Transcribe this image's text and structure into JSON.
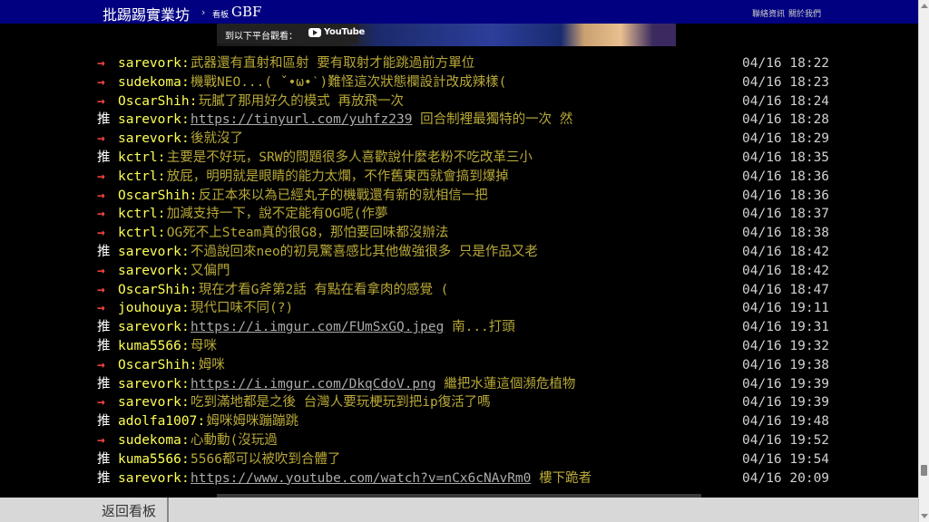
{
  "header": {
    "site_title": "批踢踢實業坊",
    "separator": "›",
    "board_prefix": "看板",
    "board_name": "GBF",
    "links": [
      "聯絡資訊",
      "關於我們"
    ]
  },
  "embed": {
    "watch_label": "到以下平台觀看：",
    "platform": "YouTube"
  },
  "pushes": [
    {
      "tag": "→",
      "user": "sarevork",
      "content": "武器還有直射和區射 要有取射才能跳過前方單位",
      "link": "",
      "after": "",
      "time": "04/16 18:22"
    },
    {
      "tag": "→",
      "user": "sudekoma",
      "content": "機戰NEO...( ˇ•ω•ˋ)難怪這次狀態欄設計改成辣樣(",
      "link": "",
      "after": "",
      "time": "04/16 18:23"
    },
    {
      "tag": "→",
      "user": "OscarShih",
      "content": "玩膩了那用好久的模式 再放飛一次",
      "link": "",
      "after": "",
      "time": "04/16 18:24"
    },
    {
      "tag": "推",
      "user": "sarevork",
      "content": "",
      "link": "https://tinyurl.com/yuhfz239",
      "after": " 回合制裡最獨特的一次 然",
      "time": "04/16 18:28"
    },
    {
      "tag": "→",
      "user": "sarevork",
      "content": "後就沒了",
      "link": "",
      "after": "",
      "time": "04/16 18:29"
    },
    {
      "tag": "推",
      "user": "kctrl",
      "content": "主要是不好玩，SRW的問題很多人喜歡說什麼老粉不吃改革三小",
      "link": "",
      "after": "",
      "time": "04/16 18:35"
    },
    {
      "tag": "→",
      "user": "kctrl",
      "content": "放屁，明明就是眼睛的能力太爛，不作舊東西就會搞到爆掉",
      "link": "",
      "after": "",
      "time": "04/16 18:36"
    },
    {
      "tag": "→",
      "user": "OscarShih",
      "content": "反正本來以為已經丸子的機戰還有新的就相信一把",
      "link": "",
      "after": "",
      "time": "04/16 18:36"
    },
    {
      "tag": "→",
      "user": "kctrl",
      "content": "加減支持一下，說不定能有OG呢(作夢",
      "link": "",
      "after": "",
      "time": "04/16 18:37"
    },
    {
      "tag": "→",
      "user": "kctrl",
      "content": "OG死不上Steam真的很G8，那怕要回味都沒辦法",
      "link": "",
      "after": "",
      "time": "04/16 18:38"
    },
    {
      "tag": "推",
      "user": "sarevork",
      "content": "不過說回來neo的初見驚喜感比其他做強很多 只是作品又老",
      "link": "",
      "after": "",
      "time": "04/16 18:42"
    },
    {
      "tag": "→",
      "user": "sarevork",
      "content": "又偏門",
      "link": "",
      "after": "",
      "time": "04/16 18:42"
    },
    {
      "tag": "→",
      "user": "OscarShih",
      "content": "現在才看G斧第2話 有點在看拿肉的感覺 (",
      "link": "",
      "after": "",
      "time": "04/16 18:47"
    },
    {
      "tag": "→",
      "user": "jouhouya",
      "content": "現代口味不同(?)",
      "link": "",
      "after": "",
      "time": "04/16 19:11"
    },
    {
      "tag": "推",
      "user": "sarevork",
      "content": "",
      "link": "https://i.imgur.com/FUmSxGQ.jpeg",
      "after": " 南...打頭",
      "time": "04/16 19:31"
    },
    {
      "tag": "推",
      "user": "kuma5566",
      "content": "母咪",
      "link": "",
      "after": "",
      "time": "04/16 19:32"
    },
    {
      "tag": "→",
      "user": "OscarShih",
      "content": "姆咪",
      "link": "",
      "after": "",
      "time": "04/16 19:38"
    },
    {
      "tag": "推",
      "user": "sarevork",
      "content": "",
      "link": "https://i.imgur.com/DkqCdoV.png",
      "after": " 繼把水蓮這個瀕危植物",
      "time": "04/16 19:39"
    },
    {
      "tag": "→",
      "user": "sarevork",
      "content": "吃到滿地都是之後 台灣人要玩梗玩到把ip復活了嗎",
      "link": "",
      "after": "",
      "time": "04/16 19:39"
    },
    {
      "tag": "推",
      "user": "adolfa1007",
      "content": "姆咪姆咪蹦蹦跳",
      "link": "",
      "after": "",
      "time": "04/16 19:48"
    },
    {
      "tag": "→",
      "user": "sudekoma",
      "content": "心動動(沒玩過",
      "link": "",
      "after": "",
      "time": "04/16 19:52"
    },
    {
      "tag": "推",
      "user": "kuma5566",
      "content": "5566都可以被吹到合體了",
      "link": "",
      "after": "",
      "time": "04/16 19:54"
    },
    {
      "tag": "推",
      "user": "sarevork",
      "content": "",
      "link": "https://www.youtube.com/watch?v=nCx6cNAvRm0",
      "after": " 樓下跪者",
      "time": "04/16 20:09"
    }
  ],
  "footer": {
    "back_label": "返回看板"
  },
  "colors": {
    "header_bg": "#000080",
    "user": "#ffff55",
    "content": "#b8a838",
    "arrow": "#ff4444",
    "push_good": "#ffffff",
    "time": "#d0d0d0"
  }
}
